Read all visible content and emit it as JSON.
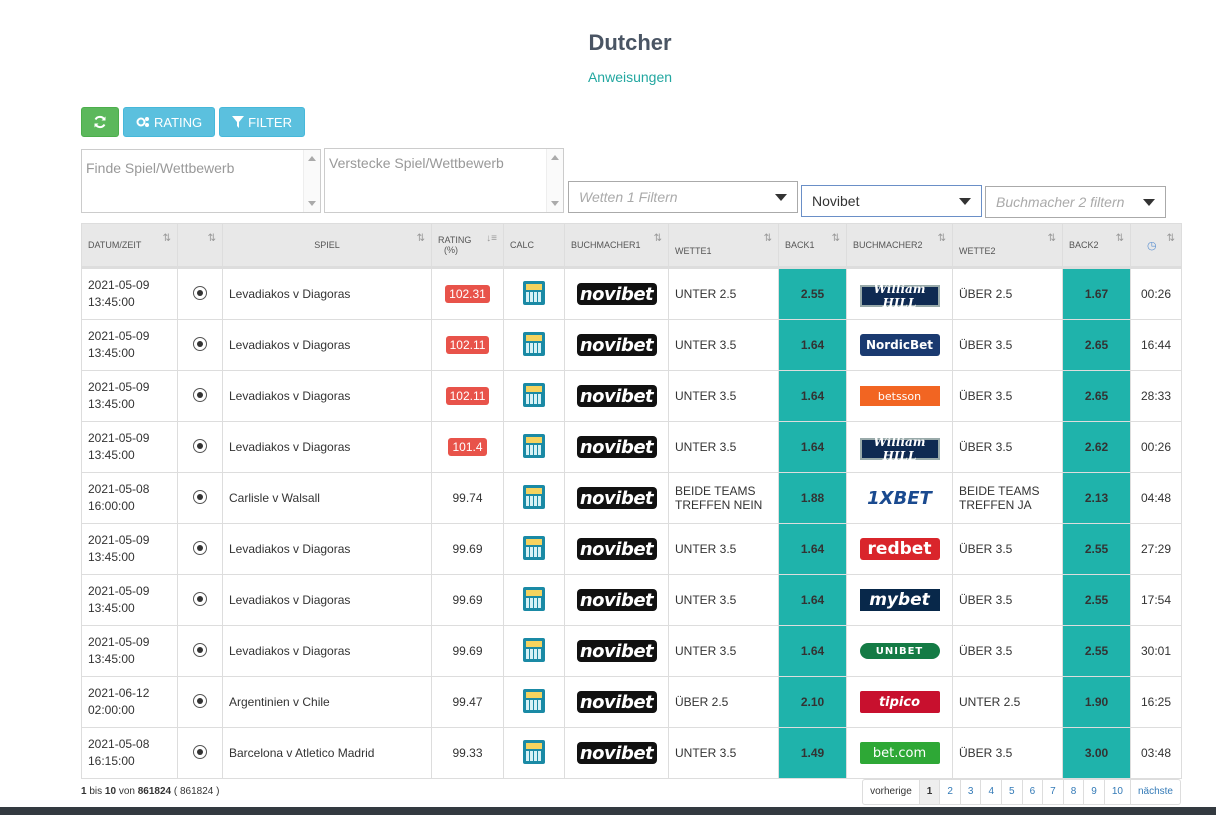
{
  "page": {
    "title": "Dutcher",
    "instructions_link": "Anweisungen"
  },
  "toolbar": {
    "rating_label": "RATING",
    "filter_label": "FILTER"
  },
  "filters": {
    "find_placeholder": "Finde Spiel/Wettbewerb",
    "hide_placeholder": "Verstecke Spiel/Wettbewerb",
    "bet1_placeholder": "Wetten 1 Filtern",
    "bookmaker1_value": "Novibet",
    "bookmaker2_placeholder": "Buchmacher 2 filtern"
  },
  "table": {
    "headers": {
      "datetime": "DATUM/ZEIT",
      "game": "SPIEL",
      "rating": "RATING",
      "rating_unit": "(%)",
      "calc": "CALC",
      "bookmaker1": "BUCHMACHER1",
      "bet1": "WETTE1",
      "back1": "BACK1",
      "bookmaker2": "BUCHMACHER2",
      "bet2": "WETTE2",
      "back2": "BACK2"
    },
    "rows": [
      {
        "date": "2021-05-09",
        "time": "13:45:00",
        "game": "Levadiakos v Diagoras",
        "rating": "102.31",
        "rating_highlight": true,
        "bookmaker1": "novibet",
        "bet1": "UNTER 2.5",
        "back1": "2.55",
        "bookmaker2": "William HILL",
        "bet2": "ÜBER 2.5",
        "back2": "1.67",
        "age": "00:26"
      },
      {
        "date": "2021-05-09",
        "time": "13:45:00",
        "game": "Levadiakos v Diagoras",
        "rating": "102.11",
        "rating_highlight": true,
        "bookmaker1": "novibet",
        "bet1": "UNTER 3.5",
        "back1": "1.64",
        "bookmaker2": "NordicBet",
        "bet2": "ÜBER 3.5",
        "back2": "2.65",
        "age": "16:44"
      },
      {
        "date": "2021-05-09",
        "time": "13:45:00",
        "game": "Levadiakos v Diagoras",
        "rating": "102.11",
        "rating_highlight": true,
        "bookmaker1": "novibet",
        "bet1": "UNTER 3.5",
        "back1": "1.64",
        "bookmaker2": "betsson",
        "bet2": "ÜBER 3.5",
        "back2": "2.65",
        "age": "28:33"
      },
      {
        "date": "2021-05-09",
        "time": "13:45:00",
        "game": "Levadiakos v Diagoras",
        "rating": "101.4",
        "rating_highlight": true,
        "bookmaker1": "novibet",
        "bet1": "UNTER 3.5",
        "back1": "1.64",
        "bookmaker2": "William HILL",
        "bet2": "ÜBER 3.5",
        "back2": "2.62",
        "age": "00:26"
      },
      {
        "date": "2021-05-08",
        "time": "16:00:00",
        "game": "Carlisle v Walsall",
        "rating": "99.74",
        "rating_highlight": false,
        "bookmaker1": "novibet",
        "bet1": "BEIDE TEAMS TREFFEN NEIN",
        "back1": "1.88",
        "bookmaker2": "1XBET",
        "bet2": "BEIDE TEAMS TREFFEN JA",
        "back2": "2.13",
        "age": "04:48"
      },
      {
        "date": "2021-05-09",
        "time": "13:45:00",
        "game": "Levadiakos v Diagoras",
        "rating": "99.69",
        "rating_highlight": false,
        "bookmaker1": "novibet",
        "bet1": "UNTER 3.5",
        "back1": "1.64",
        "bookmaker2": "redbet",
        "bet2": "ÜBER 3.5",
        "back2": "2.55",
        "age": "27:29"
      },
      {
        "date": "2021-05-09",
        "time": "13:45:00",
        "game": "Levadiakos v Diagoras",
        "rating": "99.69",
        "rating_highlight": false,
        "bookmaker1": "novibet",
        "bet1": "UNTER 3.5",
        "back1": "1.64",
        "bookmaker2": "mybet",
        "bet2": "ÜBER 3.5",
        "back2": "2.55",
        "age": "17:54"
      },
      {
        "date": "2021-05-09",
        "time": "13:45:00",
        "game": "Levadiakos v Diagoras",
        "rating": "99.69",
        "rating_highlight": false,
        "bookmaker1": "novibet",
        "bet1": "UNTER 3.5",
        "back1": "1.64",
        "bookmaker2": "UNIBET",
        "bet2": "ÜBER 3.5",
        "back2": "2.55",
        "age": "30:01"
      },
      {
        "date": "2021-06-12",
        "time": "02:00:00",
        "game": "Argentinien v Chile",
        "rating": "99.47",
        "rating_highlight": false,
        "bookmaker1": "novibet",
        "bet1": "ÜBER 2.5",
        "back1": "2.10",
        "bookmaker2": "tipico",
        "bet2": "UNTER 2.5",
        "back2": "1.90",
        "age": "16:25"
      },
      {
        "date": "2021-05-08",
        "time": "16:15:00",
        "game": "Barcelona v Atletico Madrid",
        "rating": "99.33",
        "rating_highlight": false,
        "bookmaker1": "novibet",
        "bet1": "UNTER 3.5",
        "back1": "1.49",
        "bookmaker2": "bet.com",
        "bet2": "ÜBER 3.5",
        "back2": "3.00",
        "age": "03:48"
      }
    ]
  },
  "footer": {
    "range_start": "1",
    "range_sep": "bis",
    "range_end": "10",
    "of_label": "von",
    "total": "861824",
    "total_filtered": "( 861824 )"
  },
  "pagination": {
    "prev": "vorherige",
    "pages": [
      "1",
      "2",
      "3",
      "4",
      "5",
      "6",
      "7",
      "8",
      "9",
      "10"
    ],
    "active": "1",
    "next": "nächste"
  },
  "colors": {
    "accent_teal": "#1fb3ab",
    "rating_red": "#e8534a",
    "refresh_green": "#5cb85c",
    "button_blue": "#5bc0de"
  }
}
